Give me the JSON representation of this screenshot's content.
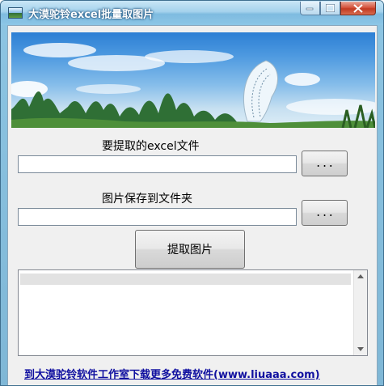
{
  "window": {
    "title": "大漠驼铃excel批量取图片",
    "icon": "app-icon"
  },
  "extract_file": {
    "label": "要提取的excel文件",
    "value": "",
    "browse_label": "..."
  },
  "save_folder": {
    "label": "图片保存到文件夹",
    "value": "",
    "browse_label": "..."
  },
  "extract_button": {
    "label": "提取图片"
  },
  "log_list": {
    "items": [
      ""
    ]
  },
  "footer": {
    "link_text": "到大漠驼铃软件工作室下载更多免费软件(www.liuaaa.com)"
  }
}
